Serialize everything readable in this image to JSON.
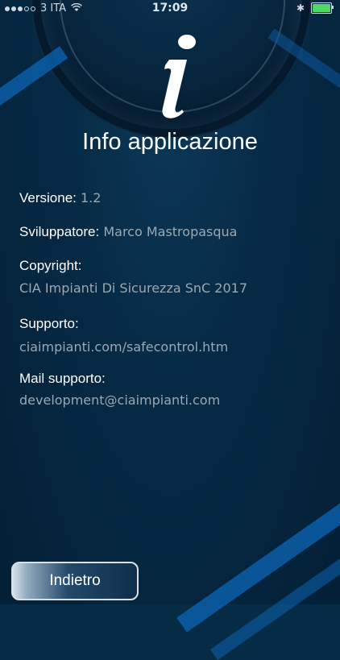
{
  "status_bar": {
    "carrier": "3 ITA",
    "time": "17:09",
    "battery_color": "#4cd964"
  },
  "header": {
    "icon": "info-icon",
    "title": "Info applicazione"
  },
  "fields": {
    "version_label": "Versione:",
    "version_value": "1.2",
    "developer_label": "Sviluppatore:",
    "developer_value": "Marco Mastropasqua",
    "copyright_label": "Copyright:",
    "copyright_value": "CIA Impianti Di Sicurezza SnC 2017",
    "support_label": "Supporto:",
    "support_value": "ciaimpianti.com/safecontrol.htm",
    "mail_label": "Mail supporto:",
    "mail_value": "development@ciaimpianti.com"
  },
  "actions": {
    "back_label": "Indietro"
  },
  "colors": {
    "background": "#062b45",
    "accent_stripe": "#0a5ea8",
    "value_text": "#9aa8b4"
  }
}
